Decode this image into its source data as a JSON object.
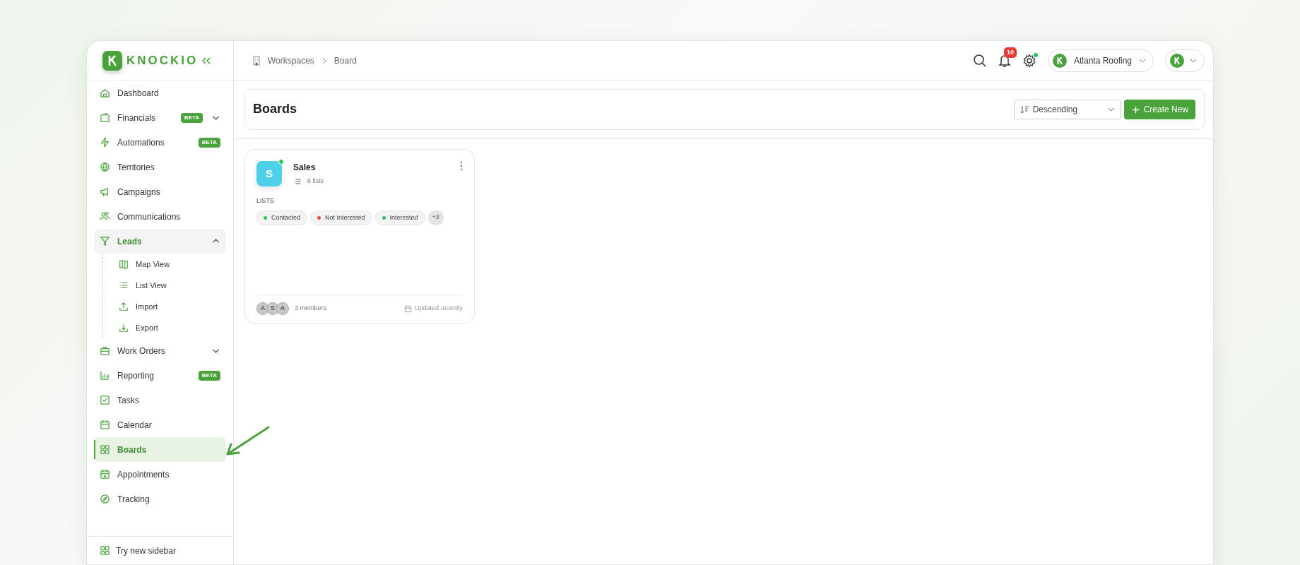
{
  "logo": {
    "text": "KNOCKIO"
  },
  "sidebar": {
    "items": [
      {
        "label": "Dashboard",
        "selected": false
      },
      {
        "label": "Financials",
        "badge": "BETA",
        "expanded": false,
        "selected": false
      },
      {
        "label": "Automations",
        "badge": "BETA",
        "selected": false
      },
      {
        "label": "Territories",
        "selected": false
      },
      {
        "label": "Campaigns",
        "selected": false
      },
      {
        "label": "Communications",
        "selected": false
      },
      {
        "label": "Leads",
        "expanded": true,
        "selected": false,
        "children": [
          {
            "label": "Map View",
            "selected": false
          },
          {
            "label": "List View",
            "selected": false
          },
          {
            "label": "Import",
            "selected": false
          },
          {
            "label": "Export",
            "selected": false
          }
        ]
      },
      {
        "label": "Work Orders",
        "expanded": false,
        "selected": false
      },
      {
        "label": "Reporting",
        "badge": "BETA",
        "selected": false
      },
      {
        "label": "Tasks",
        "selected": false
      },
      {
        "label": "Calendar",
        "selected": false
      },
      {
        "label": "Boards",
        "selected": true
      },
      {
        "label": "Appointments",
        "selected": false
      },
      {
        "label": "Tracking",
        "selected": false
      }
    ],
    "footer": "Try new sidebar"
  },
  "breadcrumb": [
    "Workspaces",
    "Board"
  ],
  "header": {
    "notifications": "10",
    "company": "Atlanta Roofing"
  },
  "page": {
    "title": "Boards",
    "sort": "Descending",
    "create_button": "Create New"
  },
  "boards": [
    {
      "initial": "S",
      "name": "Sales",
      "list_count": "6 lists",
      "lists_heading": "LISTS",
      "lists": [
        {
          "label": "Contacted",
          "color": "#22c55e"
        },
        {
          "label": "Not Interested",
          "color": "#ef4444"
        },
        {
          "label": "Interested",
          "color": "#22c55e"
        }
      ],
      "more": "+3",
      "members": [
        "A",
        "S",
        "A"
      ],
      "members_label": "3 members",
      "updated": "Updated recently"
    }
  ]
}
